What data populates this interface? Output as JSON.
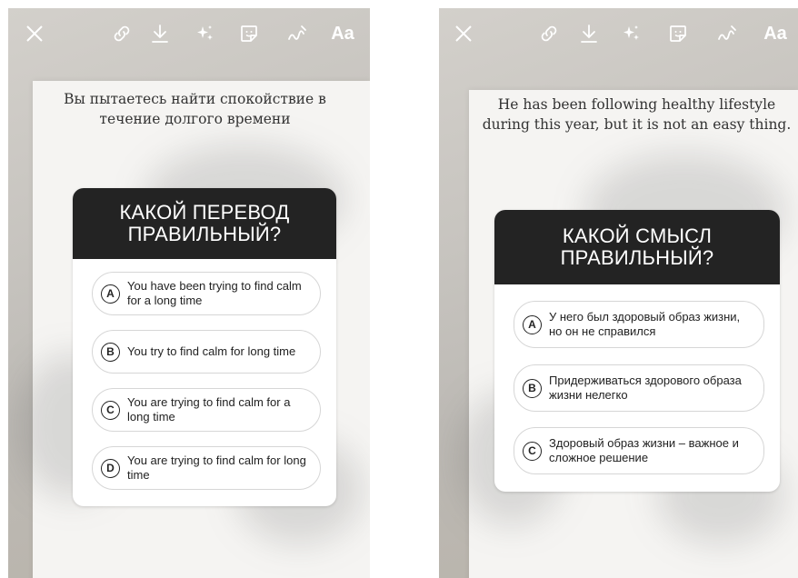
{
  "left": {
    "toolbar": {
      "close": "×",
      "text_tool": "Aa"
    },
    "caption": "Вы пытаетесь найти спокойствие в течение долгого времени",
    "quiz": {
      "title": "КАКОЙ ПЕРЕВОД ПРАВИЛЬНЫЙ?",
      "options": [
        {
          "letter": "A",
          "text": "You have been trying to find calm for a long time"
        },
        {
          "letter": "B",
          "text": "You try to find calm for long time"
        },
        {
          "letter": "C",
          "text": "You are trying to find calm for a long time"
        },
        {
          "letter": "D",
          "text": "You are trying to find calm for long time"
        }
      ]
    }
  },
  "right": {
    "toolbar": {
      "close": "×",
      "text_tool": "Aa"
    },
    "caption": "He has been following healthy lifestyle during this year, but it is not an easy thing.",
    "quiz": {
      "title": "КАКОЙ СМЫСЛ ПРАВИЛЬНЫЙ?",
      "options": [
        {
          "letter": "A",
          "text": "У него был здоровый образ жизни, но он не справился"
        },
        {
          "letter": "B",
          "text": "Придерживаться здорового образа жизни нелегко"
        },
        {
          "letter": "C",
          "text": "Здоровый образ жизни – важное и сложное решение"
        }
      ]
    }
  },
  "colors": {
    "quiz_header": "#232323",
    "option_border": "#d6d6d6",
    "background": "#c7c4bf"
  }
}
